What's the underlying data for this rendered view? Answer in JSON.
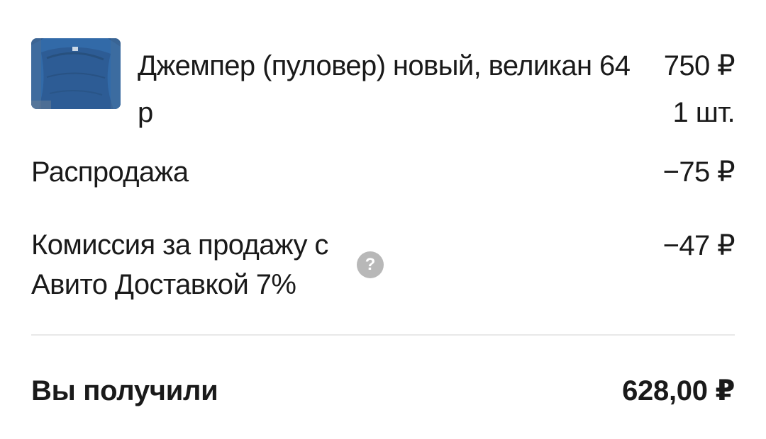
{
  "product": {
    "image_icon": "product-photo-sweater",
    "title": "Джемпер (пуловер) новый, великан 64 р",
    "price": "750 ₽",
    "quantity": "1 шт."
  },
  "sale": {
    "label": "Распродажа",
    "value": "−75 ₽"
  },
  "commission": {
    "label": "Комиссия за продажу с Авито Доставкой 7%",
    "help_icon": "question-mark-icon",
    "help_symbol": "?",
    "value": "−47 ₽"
  },
  "total": {
    "label": "Вы получили",
    "value": "628,00 ₽"
  },
  "colors": {
    "text": "#1a1a1a",
    "help_icon_bg": "#b8b8b8",
    "divider": "#e8e8e8",
    "thumb_blue": "#2f5f98"
  }
}
